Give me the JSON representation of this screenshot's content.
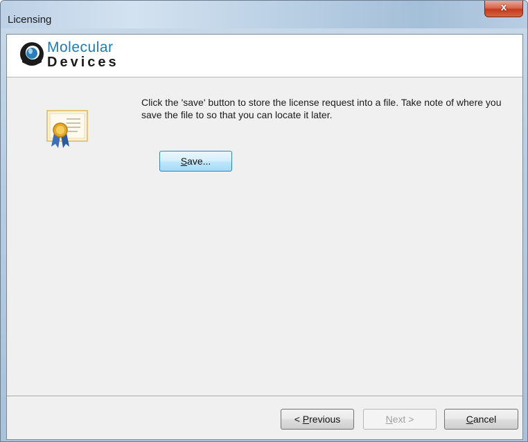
{
  "window": {
    "title": "Licensing",
    "close_glyph": "x"
  },
  "header": {
    "brand_line1": "Molecular",
    "brand_line2": "Devices",
    "logo_icon": "molecular-devices-logo-icon"
  },
  "content": {
    "icon": "certificate-icon",
    "message": "Click the 'save' button to store the license request into a file. Take note of where you save the file to so that you can locate it later.",
    "save_button": {
      "mnemonic": "S",
      "rest": "ave..."
    }
  },
  "footer": {
    "previous_button": {
      "prefix": "< ",
      "mnemonic": "P",
      "rest": "revious",
      "enabled": true
    },
    "next_button": {
      "mnemonic": "N",
      "rest": "ext >",
      "enabled": false
    },
    "cancel_button": {
      "mnemonic": "C",
      "rest": "ancel",
      "enabled": true
    }
  },
  "colors": {
    "brand_blue": "#1f7ab5",
    "client_bg": "#f0f0f0",
    "close_red": "#c23b1f"
  }
}
